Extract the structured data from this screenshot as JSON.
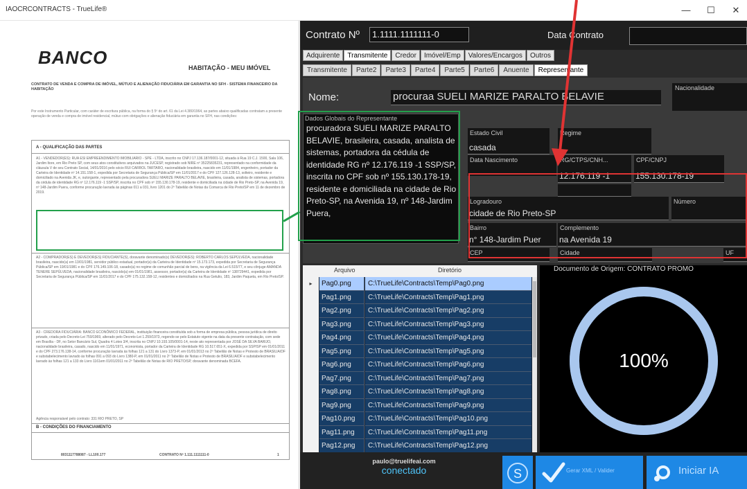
{
  "window": {
    "title": "IAOCRCONTRACTS - TrueLife®",
    "minimize_glyph": "—",
    "maximize_glyph": "☐",
    "close_glyph": "✕"
  },
  "document": {
    "bank": "BANCO",
    "habitacao": "HABITAÇÃO - MEU IMÓVEL",
    "contract_heading": "CONTRATO DE VENDA E COMPRA DE IMÓVEL, MÚTUO E ALIENAÇÃO FIDUCIÁRIA EM GARANTIA NO SFH - SISTEMA FINANCEIRO DA HABITAÇÃO",
    "intro": "Por este Instrumento Particular, com caráter de escritura pública, na forma do § 5º do art. 61 da Lei 4.380/1964, as partes abaixo qualificadas contratam a presente operação de venda e compra de imóvel residencial, mútuo com obrigações e alienação fiduciária em garantia no SFH, nas condições:",
    "section_a": "A - QUALIFICAÇÃO DAS PARTES",
    "para_a1": "A1 - VENDEDOR(ES): RUA ESI EMPREENDIMENTO IMOBILIARIO - SPE - LTDA, inscrito no CNPJ 17.136.187/0001-12, situada à Rua 19 C.J. 1500, Sala 106, Jardim Itore, em Rio Preto SP, com seus atos constitutivos arquivados na JUCESP, registrado sob NIRE nº 35225835231, representado na conformidade da cláusula V de seu Contrato Social, 14/01/2016 pelo sócio RUI CARROL TARTARO, nacionalidade brasileira, nascido em 11/01/1984, engenheiro, portador da Carteira de Identidade nº 14.151.158-1, expedida por Secretaria de Segurança Pública/SP em 11/01/2017 e do CPF 127.126.128-13, solteiro, residente e domiciliado na Avenida JK, e, outorgante, representado pela procuradora SUELI MARIZE PARALTO BELAVIE, brasileira, casada, analista de sistemas, portadora da cédula de identidade RG nº 12.176.119 -1 SSP/SP, inscrita no CPF sob nº 155.130.178-19, residente e domiciliada na cidade de Rio Preto-SP, na Avenida 19, nº 148-Jardim Puera, conforme procuração lavrada às páginas 011 a 031, livro 1201 do 2º Tabelião de Notas da Comarca de Rio Preto/SP em 11 de dezembro de 2019.",
    "para_a2": "A2 - COMPRADOR(ES) E DEVEDOR(ES) FIDUCIANTE(S), doravante denominado(s) DEVEDOR(ES): ROBERTO CARLOS SEPÚLVEDA, nacionalidade brasileira, nascido(a) em 13/01/1981, servidor público estadual, portador(a) da Carteira de Identidade nº 15.173.173, expedida por Secretaria de Segurança Pública/SP em 19/01/1981 e do CPF 176.149.106-18, casado(a) no regime de comunhão parcial de bens, na vigência da Lei 6.515/77, e seu cônjuge AMANDA TENERE SEPÚLVEDA, nacionalidade brasileira, nascido(a) em 01/01/1981, assessor, portador(a) da Carteira de Identidade nº 138729441, expedida por Secretaria de Segurança Pública/SP em 11/01/2017 e do CPF 175.132.158-12, residentes e domiciliados na Rua Getulio, 183, Jardim Paqueta, em Rio Preto/SP.",
    "para_a3": "A3 - CREDORA FIDUCIÁRIA: BANCO ECONÔMICO FEDERAL, instituição financeira constituída sob a forma de empresa pública, pessoa jurídica de direito privado, criada pelo Decreto-Lei 759/1969, alterado pelo Decreto-Lei 1.259/1973, regendo-se pelo Estatuto vigente na data da presente contratação, com sede em Brasília - DF, no Setor Bancário Sul, Quadra 4 Lotes 3/4, inscrita no CNPJ 10.193.105/0001-14, neste ato representada por JOSÉ DA SILVA BARIJO, nacionalidade brasileira, casado, nascido em 11/01/1971, economista, portador da Carteira de Identidade RG 10.517.651-X, expedida por SSP/SP em 01/01/2011 e do CPF 273.176.138-14, conforme procuração lavrada às folhas 121 a 131 do Livro 1373-P, em 01/01/2013 no 2º Tabelião de Notas e Protesto de BRASILIA/DF e substabelecimento lavrado às folhas 091 a 093 do Livro 1380-P, em 01/01/2011 no 2º Tabelião de Notas e Protesto de BRASILIA/DF e substabelecimento lavrado às folhas 121 a 133 do Livro 1161em 01/01/2011 no 2º Tabelião de Notas de RIO PRETO/SP, doravante denominada BCEFA.",
    "agencia": "Agência responsável pelo contrato: 331 RIO PRETO, SP",
    "section_b": "B - CONDIÇÕES DO FINANCIAMENTO",
    "footer_left": "8031117788087 - LL100.177",
    "footer_mid": "CONTRATO Nº 1.111.1111111-0",
    "footer_page": "1"
  },
  "form": {
    "contrato_label": "Contrato Nº",
    "contrato_value": "1.1111.1111111-0",
    "data_label": "Data Contrato",
    "data_value": "",
    "tabs": [
      "Adquirente",
      "Transmitente",
      "Credor",
      "Imóvel/Emp",
      "Valores/Encargos",
      "Outros"
    ],
    "subtabs": [
      "Transmitente",
      "Parte2",
      "Parte3",
      "Parte4",
      "Parte5",
      "Parte6",
      "Anuente",
      "Representante"
    ],
    "nome_label": "Nome:",
    "nome_value": "procuraa SUELI MARIZE PARALTO BELAVIE",
    "nacionalidade_label": "Nacionalidade",
    "dados_label": "Dados Globais do Representante",
    "dados_text": "procuradora SUELI MARIZE PARALTO BELAVIE, brasileira, casada, analista de sistemas, portadora da cédula de identidade RG nº 12.176.119 -1 SSP/SP, inscrita no CPF sob nº 155.130.178-19, residente e domiciliada na cidade de Rio Preto-SP, na Avenida 19, nº 148-Jardim Puera,",
    "estado_civil_label": "Estado Civil",
    "estado_civil_value": "casada",
    "regime_label": "Regime",
    "regime_value": "",
    "nascimento_label": "Data Nascimento",
    "rg_label": "RG/CTPS/CNH...",
    "rg_value": "12.176.119 -1",
    "cpf_label": "CPF/CNPJ",
    "cpf_value": "155.130.178-19",
    "logradouro_label": "Logradouro",
    "logradouro_value": "cidade de Rio Preto-SP",
    "numero_label": "Número",
    "bairro_label": "Bairro",
    "bairro_value": "n° 148-Jardim Puer",
    "complemento_label": "Complemento",
    "complemento_value": "na Avenida 19",
    "cep_label": "CEP",
    "cidade_label": "Cidade",
    "uf_label": "UF"
  },
  "files": {
    "col_arquivo": "Arquivo",
    "col_diretorio": "Diretório",
    "rows": [
      {
        "arquivo": "Pag0.png",
        "dir": "C:\\TrueLife\\Contracts\\Temp\\Pag0.png"
      },
      {
        "arquivo": "Pag1.png",
        "dir": "C:\\TrueLife\\Contracts\\Temp\\Pag1.png"
      },
      {
        "arquivo": "Pag2.png",
        "dir": "C:\\TrueLife\\Contracts\\Temp\\Pag2.png"
      },
      {
        "arquivo": "Pag3.png",
        "dir": "C:\\TrueLife\\Contracts\\Temp\\Pag3.png"
      },
      {
        "arquivo": "Pag4.png",
        "dir": "C:\\TrueLife\\Contracts\\Temp\\Pag4.png"
      },
      {
        "arquivo": "Pag5.png",
        "dir": "C:\\TrueLife\\Contracts\\Temp\\Pag5.png"
      },
      {
        "arquivo": "Pag6.png",
        "dir": "C:\\TrueLife\\Contracts\\Temp\\Pag6.png"
      },
      {
        "arquivo": "Pag7.png",
        "dir": "C:\\TrueLife\\Contracts\\Temp\\Pag7.png"
      },
      {
        "arquivo": "Pag8.png",
        "dir": "C:\\TrueLife\\Contracts\\Temp\\Pag8.png"
      },
      {
        "arquivo": "Pag9.png",
        "dir": "C:\\TrueLife\\Contracts\\Temp\\Pag9.png"
      },
      {
        "arquivo": "Pag10.png",
        "dir": "C:\\TrueLife\\Contracts\\Temp\\Pag10.png"
      },
      {
        "arquivo": "Pag11.png",
        "dir": "C:\\TrueLife\\Contracts\\Temp\\Pag11.png"
      },
      {
        "arquivo": "Pag12.png",
        "dir": "C:\\TrueLife\\Contracts\\Temp\\Pag12.png"
      }
    ]
  },
  "viewer": {
    "title": "Documento de Origem: CONTRATO PROMO",
    "progress_text": "100%",
    "progress": 1.0
  },
  "status": {
    "email": "paulo@truelifeai.com",
    "state": "conectado"
  },
  "buttons": {
    "s_icon_glyph": "S",
    "gerar_label": "Gerar XML / Valider",
    "iniciar_label": "Iniciar IA"
  },
  "colors": {
    "accent": "#1e88e5",
    "annotation_green": "#22a04b",
    "annotation_red": "#e03333",
    "status_connected": "#4fc3f7"
  }
}
